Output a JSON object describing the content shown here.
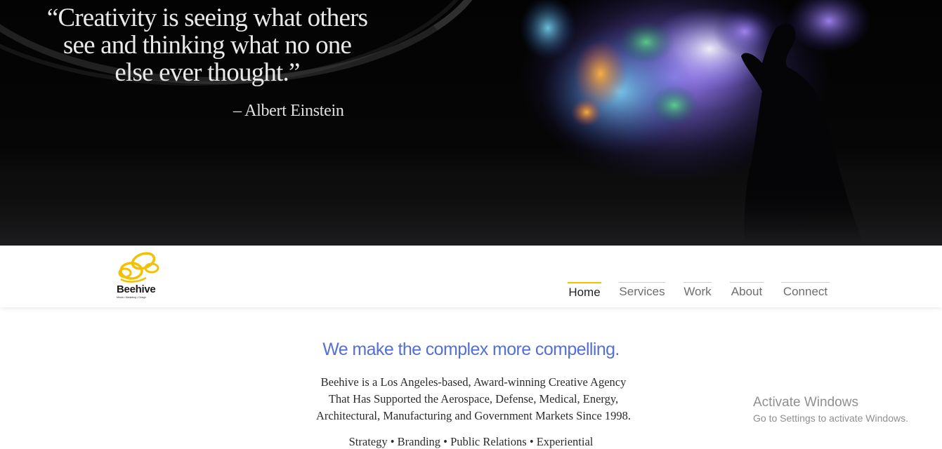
{
  "hero": {
    "quote_lines": [
      "“Creativity is seeing what others",
      "see and thinking what no one",
      "else ever thought.”"
    ],
    "author": "– Albert Einstein"
  },
  "brand": {
    "name": "Beehive",
    "tagline": "Media • Marketing • Design",
    "accent_color": "#f2c100"
  },
  "nav": {
    "items": [
      {
        "label": "Home",
        "active": true
      },
      {
        "label": "Services",
        "active": false
      },
      {
        "label": "Work",
        "active": false
      },
      {
        "label": "About",
        "active": false
      },
      {
        "label": "Connect",
        "active": false
      }
    ]
  },
  "main": {
    "headline": "We make the complex more compelling.",
    "headline_color": "#5470d6",
    "description_lines": [
      "Beehive is a Los Angeles-based, Award-winning Creative Agency",
      "That Has Supported the Aerospace, Defense, Medical, Energy,",
      "Architectural, Manufacturing and Government Markets Since 1998."
    ],
    "services_line": "Strategy • Branding • Public Relations • Experiential"
  },
  "watermark": {
    "title": "Activate Windows",
    "subtitle": "Go to Settings to activate Windows."
  }
}
